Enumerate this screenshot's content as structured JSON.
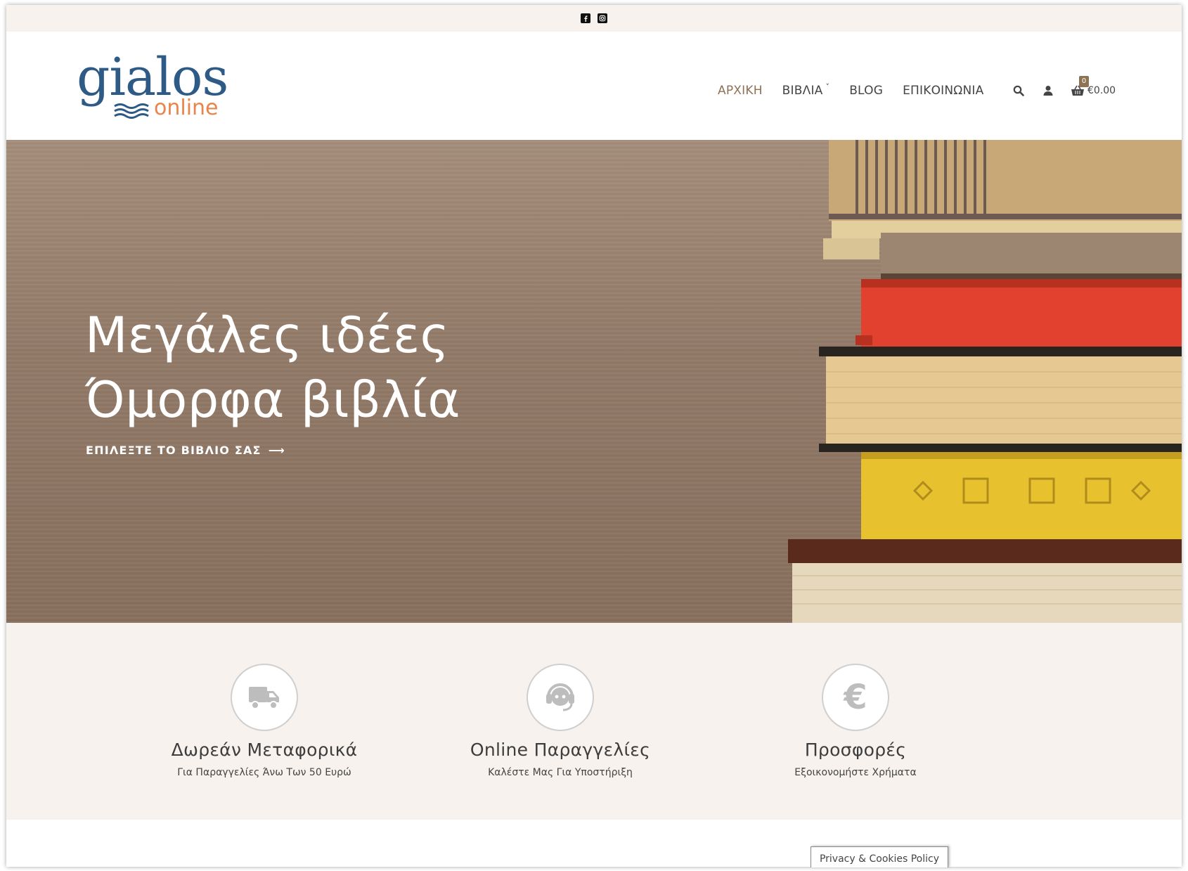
{
  "topbar": {
    "icons": [
      "facebook-icon",
      "instagram-icon"
    ]
  },
  "header": {
    "logo_main": "gialos",
    "logo_sub": "online",
    "nav": [
      {
        "label": "ΑΡΧΙΚΗ",
        "active": true
      },
      {
        "label": "ΒΙΒΛΙΑ",
        "dropdown": true
      },
      {
        "label": "BLOG"
      },
      {
        "label": "ΕΠΙΚΟΙΝΩΝΙΑ"
      }
    ],
    "cart_count": "0",
    "cart_total": "€0.00"
  },
  "hero": {
    "title_line1": "Μεγάλες ιδέες",
    "title_line2": "Όμορφα βιβλία",
    "cta": "ΕΠΙΛΕΞΤΕ ΤΟ ΒΙΒΛΙΟ ΣΑΣ",
    "cta_arrow": "⟶"
  },
  "features": [
    {
      "icon": "truck-icon",
      "title": "Δωρεάν Μεταφορικά",
      "subtitle": "Για Παραγγελίες Άνω Των 50 Ευρώ"
    },
    {
      "icon": "headset-icon",
      "title": "Online Παραγγελίες",
      "subtitle": "Καλέστε Μας Για Υποστήριξη"
    },
    {
      "icon": "euro-icon",
      "title": "Προσφορές",
      "subtitle": "Εξοικονομήστε Χρήματα"
    }
  ],
  "privacy": {
    "label": "Privacy & Cookies Policy"
  },
  "colors": {
    "accent": "#8e7254",
    "logo_blue": "#2e5b86",
    "logo_orange": "#e9844b",
    "band_bg": "#f7f2ee"
  }
}
